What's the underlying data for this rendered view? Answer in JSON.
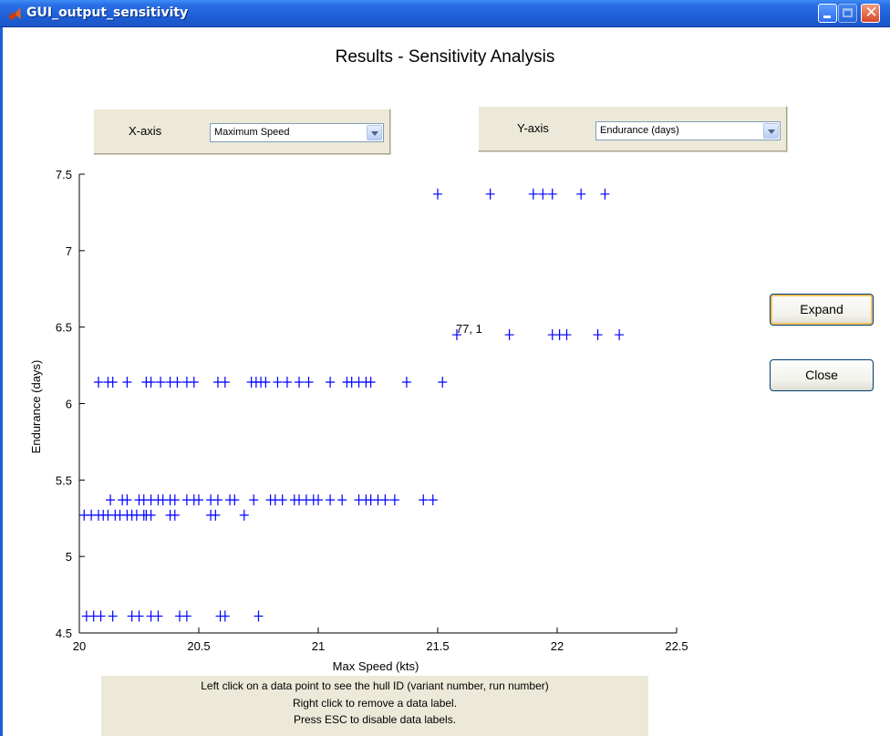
{
  "window": {
    "title": "GUI_output_sensitivity",
    "close_glyph": "✕"
  },
  "page_title": "Results - Sensitivity Analysis",
  "x_axis_panel": {
    "label": "X-axis",
    "selected": "Maximum Speed"
  },
  "y_axis_panel": {
    "label": "Y-axis",
    "selected": "Endurance (days)"
  },
  "buttons": {
    "expand": "Expand",
    "close": "Close"
  },
  "data_tip": "77, 1",
  "status_lines": [
    "Left click on a data point to see the hull ID (variant number, run number)",
    "Right click to remove a data label.",
    "Press ESC to disable data labels."
  ],
  "colors": {
    "marker": "#0000ff",
    "panel": "#ece9d8",
    "titlebar": "#2a6fe6"
  },
  "chart_data": {
    "type": "scatter",
    "title": "",
    "xlabel": "Max Speed (kts)",
    "ylabel": "Endurance (days)",
    "xlim": [
      20,
      22.5
    ],
    "ylim": [
      4.5,
      7.5
    ],
    "xticks": [
      20,
      20.5,
      21,
      21.5,
      22,
      22.5
    ],
    "xtick_labels": [
      "20",
      "20.5",
      "21",
      "21.5",
      "22",
      "22.5"
    ],
    "yticks": [
      4.5,
      5,
      5.5,
      6,
      6.5,
      7,
      7.5
    ],
    "ytick_labels": [
      "4.5",
      "5",
      "5.5",
      "6",
      "6.5",
      "7",
      "7.5"
    ],
    "marker": "+",
    "grid": false,
    "annotation": {
      "text": "77, 1",
      "x": 21.58,
      "y": 6.45
    },
    "series": [
      {
        "x": [
          20.02,
          20.05,
          20.08,
          20.1,
          20.12,
          20.15,
          20.17,
          20.2,
          20.22,
          20.24,
          20.27,
          20.28,
          20.3,
          20.38,
          20.4,
          20.55,
          20.57,
          20.69,
          20.13,
          20.18,
          20.2,
          20.25,
          20.27,
          20.3,
          20.33,
          20.35,
          20.38,
          20.4,
          20.45,
          20.48,
          20.5,
          20.55,
          20.58,
          20.63,
          20.65,
          20.73,
          20.8,
          20.82,
          20.85,
          20.9,
          20.92,
          20.95,
          20.98,
          21.0,
          21.05,
          21.1,
          21.17,
          21.2,
          21.22,
          21.25,
          21.28,
          21.32,
          21.44,
          21.48,
          20.08,
          20.12,
          20.14,
          20.2,
          20.28,
          20.3,
          20.34,
          20.38,
          20.41,
          20.45,
          20.48,
          20.58,
          20.61,
          20.72,
          20.74,
          20.76,
          20.78,
          20.83,
          20.87,
          20.92,
          20.96,
          21.05,
          21.12,
          21.14,
          21.17,
          21.2,
          21.22,
          21.37,
          21.52,
          21.5,
          21.72,
          21.9,
          21.94,
          21.98,
          22.1,
          22.2,
          21.58,
          21.8,
          21.98,
          22.01,
          22.04,
          22.17,
          22.26,
          20.03,
          20.06,
          20.09,
          20.14,
          20.22,
          20.25,
          20.3,
          20.33,
          20.42,
          20.45,
          20.59,
          20.61,
          20.75
        ],
        "y": [
          5.27,
          5.27,
          5.27,
          5.27,
          5.27,
          5.27,
          5.27,
          5.27,
          5.27,
          5.27,
          5.27,
          5.27,
          5.27,
          5.27,
          5.27,
          5.27,
          5.27,
          5.27,
          5.37,
          5.37,
          5.37,
          5.37,
          5.37,
          5.37,
          5.37,
          5.37,
          5.37,
          5.37,
          5.37,
          5.37,
          5.37,
          5.37,
          5.37,
          5.37,
          5.37,
          5.37,
          5.37,
          5.37,
          5.37,
          5.37,
          5.37,
          5.37,
          5.37,
          5.37,
          5.37,
          5.37,
          5.37,
          5.37,
          5.37,
          5.37,
          5.37,
          5.37,
          5.37,
          5.37,
          6.14,
          6.14,
          6.14,
          6.14,
          6.14,
          6.14,
          6.14,
          6.14,
          6.14,
          6.14,
          6.14,
          6.14,
          6.14,
          6.14,
          6.14,
          6.14,
          6.14,
          6.14,
          6.14,
          6.14,
          6.14,
          6.14,
          6.14,
          6.14,
          6.14,
          6.14,
          6.14,
          6.14,
          6.14,
          7.37,
          7.37,
          7.37,
          7.37,
          7.37,
          7.37,
          7.37,
          6.45,
          6.45,
          6.45,
          6.45,
          6.45,
          6.45,
          6.45,
          4.61,
          4.61,
          4.61,
          4.61,
          4.61,
          4.61,
          4.61,
          4.61,
          4.61,
          4.61,
          4.61,
          4.61,
          4.61
        ]
      }
    ]
  }
}
